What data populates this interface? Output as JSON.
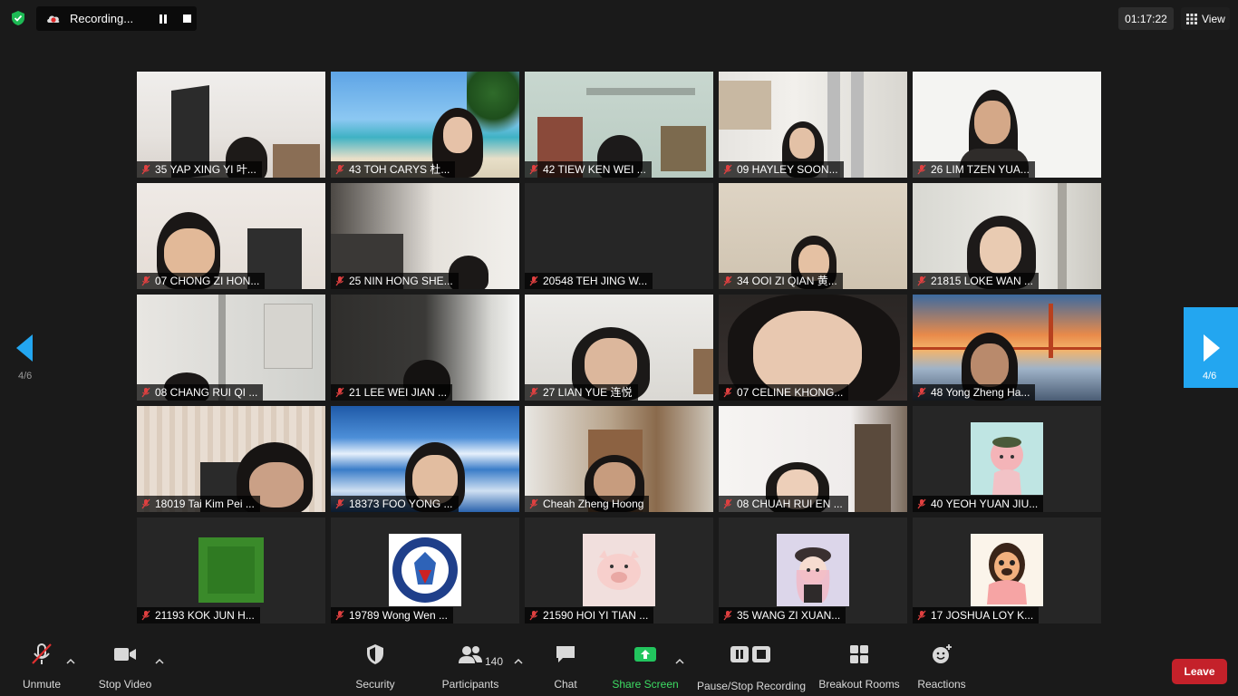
{
  "recording": {
    "label": "Recording..."
  },
  "timer": "01:17:22",
  "view_label": "View",
  "page_indicator": "4/6",
  "participants": [
    {
      "name": "35 YAP XING YI 叶..."
    },
    {
      "name": "43 TOH CARYS 杜..."
    },
    {
      "name": "42 TIEW KEN WEI ..."
    },
    {
      "name": "09 HAYLEY SOON..."
    },
    {
      "name": "26 LIM TZEN YUA..."
    },
    {
      "name": "07 CHONG ZI HON..."
    },
    {
      "name": "25 NIN HONG SHE..."
    },
    {
      "name": "20548 TEH JING W..."
    },
    {
      "name": "34 OOI ZI QIAN 黄..."
    },
    {
      "name": "21815 LOKE WAN ..."
    },
    {
      "name": "08 CHANG RUI QI ..."
    },
    {
      "name": "21 LEE WEI JIAN ..."
    },
    {
      "name": "27 LIAN YUE 连悦"
    },
    {
      "name": "07 CELINE KHONG..."
    },
    {
      "name": "48 Yong Zheng Ha..."
    },
    {
      "name": "18019 Tai Kim Pei ..."
    },
    {
      "name": "18373 FOO YONG ..."
    },
    {
      "name": "Cheah Zheng Hoong"
    },
    {
      "name": "08 CHUAH RUI EN ..."
    },
    {
      "name": "40 YEOH YUAN JIU..."
    },
    {
      "name": "21193 KOK JUN H..."
    },
    {
      "name": "19789 Wong Wen ..."
    },
    {
      "name": "21590 HOI YI TIAN ..."
    },
    {
      "name": "35 WANG ZI XUAN..."
    },
    {
      "name": "17 JOSHUA LOY K..."
    }
  ],
  "toolbar": {
    "unmute": "Unmute",
    "stop_video": "Stop Video",
    "security": "Security",
    "participants": "Participants",
    "participants_count": "140",
    "chat": "Chat",
    "share_screen": "Share Screen",
    "pause_stop_recording": "Pause/Stop Recording",
    "breakout_rooms": "Breakout Rooms",
    "reactions": "Reactions",
    "leave": "Leave"
  },
  "colors": {
    "share_green": "#22c55e",
    "leave_red": "#c4212a",
    "nav_blue": "#23a6f0"
  }
}
